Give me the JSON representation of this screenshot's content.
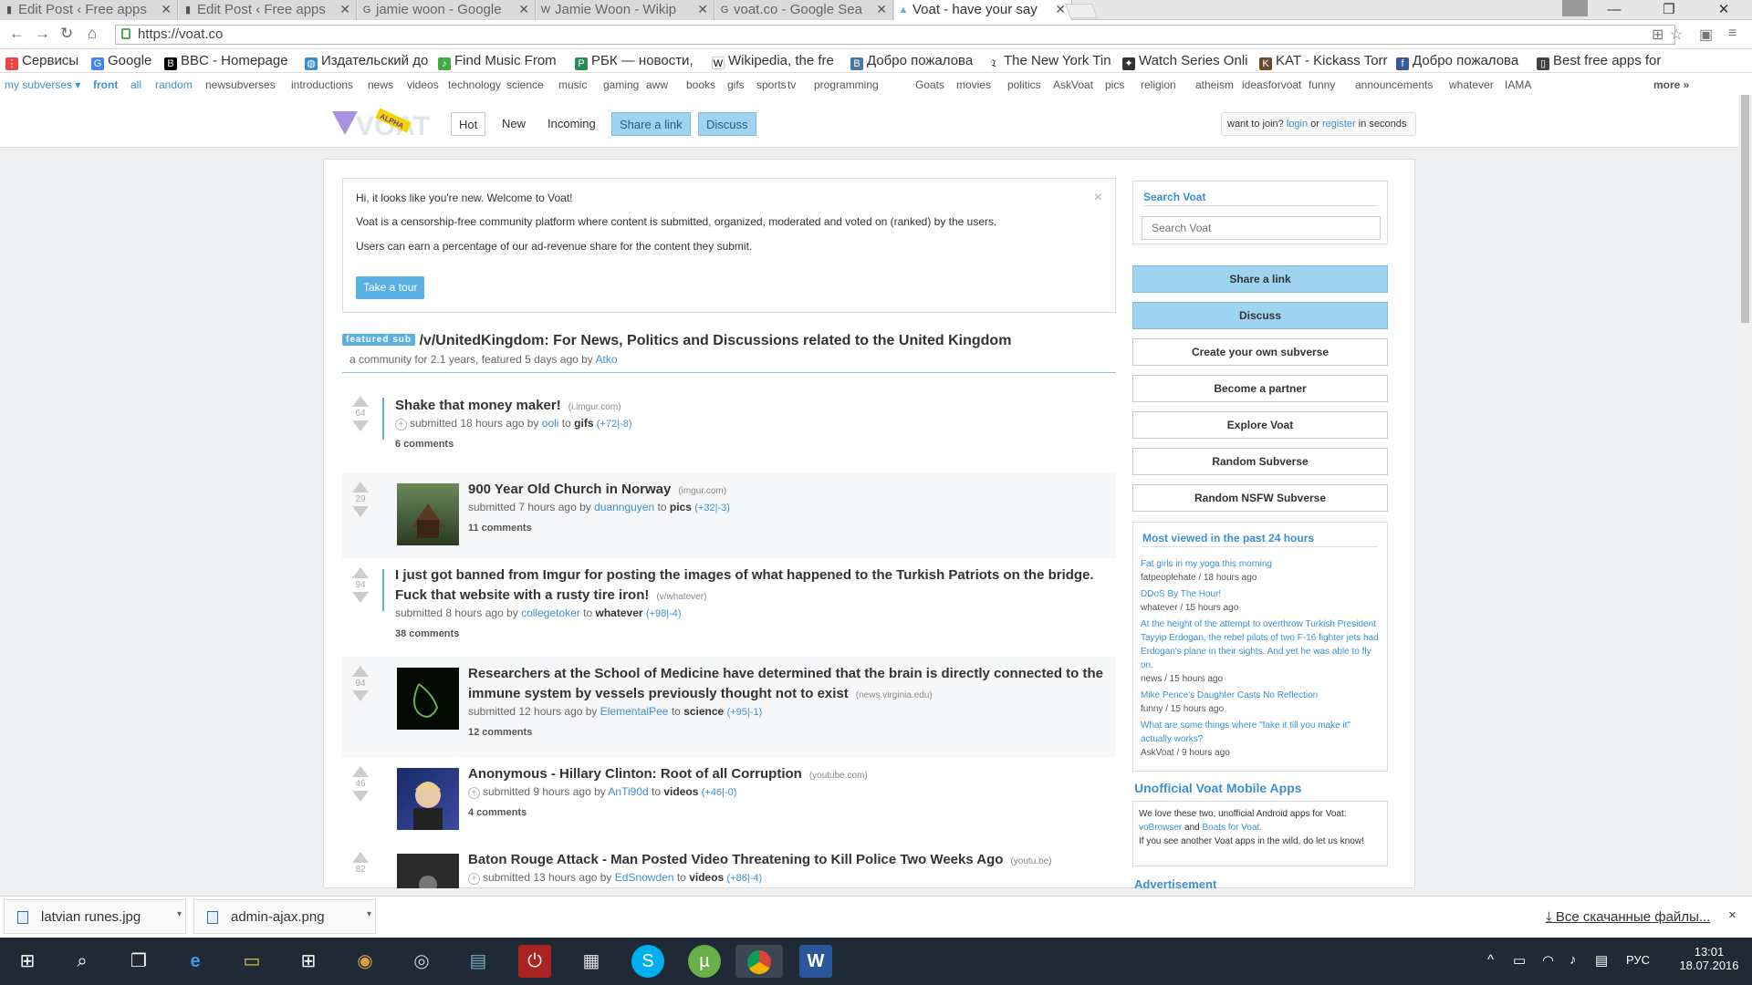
{
  "tabs": [
    {
      "label": "Edit Post ‹ Free apps"
    },
    {
      "label": "Edit Post ‹ Free apps"
    },
    {
      "label": "jamie woon - Google"
    },
    {
      "label": "Jamie Woon - Wikip"
    },
    {
      "label": "voat.co - Google Sea"
    },
    {
      "label": "Voat - have your say"
    }
  ],
  "url": "https://voat.co",
  "bookmarks": [
    "Сервисы",
    "Google",
    "BBC - Homepage",
    "Издательский до",
    "Find Music From",
    "РБК — новости,",
    "Wikipedia, the fre",
    "Добро пожалова",
    "The New York Tin",
    "Watch Series Onli",
    "KAT - Kickass Torr",
    "Добро пожалова",
    "Best free apps for"
  ],
  "subbar": {
    "my_subverses": "my subverses ▾",
    "items": [
      "front",
      "all",
      "random",
      "newsubverses",
      "introductions",
      "news",
      "videos",
      "technology",
      "science",
      "music",
      "gaming",
      "aww",
      "books",
      "gifs",
      "sports",
      "tv",
      "programming",
      "Goats",
      "movies",
      "politics",
      "AskVoat",
      "pics",
      "religion",
      "atheism",
      "ideasforvoat",
      "funny",
      "announcements",
      "whatever",
      "IAMA"
    ],
    "more": "more »"
  },
  "header": {
    "logo_text": "VOAT",
    "logo_badge": "ALPHA",
    "hot": "Hot",
    "new": "New",
    "incoming": "Incoming",
    "share": "Share a link",
    "discuss": "Discuss",
    "join_prefix": "want to join?",
    "login": "login",
    "or": "or",
    "register": "register",
    "join_suffix": "in seconds"
  },
  "welcome": {
    "line1": "Hi, it looks like you're new. Welcome to Voat!",
    "line2": "Voat is a censorship-free community platform where content is submitted, organized, moderated and voted on (ranked) by the users.",
    "line3": "Users can earn a percentage of our ad-revenue share for the content they submit.",
    "tour": "Take a tour",
    "close": "×"
  },
  "featured": {
    "badge": "featured sub",
    "title": "/v/UnitedKingdom: For News, Politics and Discussions related to the United Kingdom",
    "meta": "a community for 2.1 years, featured 5 days ago by",
    "user": "Atko"
  },
  "posts": [
    {
      "score": "64",
      "title": "Shake that money maker!",
      "domain": "(i.imgur.com)",
      "submitted": "submitted 18 hours ago by",
      "user": "ooli",
      "to": "to",
      "sub": "gifs",
      "ups": "+72",
      "sep": "|",
      "downs": "-8",
      "comments": "6 comments"
    },
    {
      "score": "29",
      "title": "900 Year Old Church in Norway",
      "domain": "(imgur.com)",
      "submitted": "submitted 7 hours ago by",
      "user": "duannguyen",
      "to": "to",
      "sub": "pics",
      "ups": "+32",
      "sep": "|",
      "downs": "-3",
      "comments": "11 comments"
    },
    {
      "score": "94",
      "title": "I just got banned from Imgur for posting the images of what happened to the Turkish Patriots on the bridge. Fuck that website with a rusty tire iron!",
      "domain": "(v/whatever)",
      "submitted": "submitted 8 hours ago by",
      "user": "collegetoker",
      "to": "to",
      "sub": "whatever",
      "ups": "+98",
      "sep": "|",
      "downs": "-4",
      "comments": "38 comments"
    },
    {
      "score": "94",
      "title": "Researchers at the School of Medicine have determined that the brain is directly connected to the immune system by vessels previously thought not to exist",
      "domain": "(news.virginia.edu)",
      "submitted": "submitted 12 hours ago by",
      "user": "ElementalPee",
      "to": "to",
      "sub": "science",
      "ups": "+95",
      "sep": "|",
      "downs": "-1",
      "comments": "12 comments"
    },
    {
      "score": "46",
      "title": "Anonymous - Hillary Clinton: Root of all Corruption",
      "domain": "(youtube.com)",
      "submitted": "submitted 9 hours ago by",
      "user": "AnTi90d",
      "to": "to",
      "sub": "videos",
      "ups": "+46",
      "sep": "|",
      "downs": "-0",
      "comments": "4 comments"
    },
    {
      "score": "82",
      "title": "Baton Rouge Attack - Man Posted Video Threatening to Kill Police Two Weeks Ago",
      "domain": "(youtu.be)",
      "submitted": "submitted 13 hours ago by",
      "user": "EdSnowden",
      "to": "to",
      "sub": "videos",
      "ups": "+86",
      "sep": "|",
      "downs": "-4",
      "comments": ""
    }
  ],
  "sidebar": {
    "search_title": "Search Voat",
    "search_placeholder": "Search Voat",
    "share": "Share a link",
    "discuss": "Discuss",
    "create": "Create your own subverse",
    "partner": "Become a partner",
    "explore": "Explore Voat",
    "random": "Random Subverse",
    "random_nsfw": "Random NSFW Subverse",
    "most_viewed_title": "Most viewed in the past 24 hours",
    "most_viewed": [
      {
        "title": "Fat girls in my yoga this morning",
        "meta": "fatpeoplehate / 18 hours ago"
      },
      {
        "title": "DDoS By The Hour!",
        "meta": "whatever / 15 hours ago"
      },
      {
        "title": "At the height of the attempt to overthrow Turkish President Tayyip Erdogan, the rebel pilots of two F-16 fighter jets had Erdogan's plane in their sights. And yet he was able to fly on.",
        "meta": "news / 15 hours ago"
      },
      {
        "title": "Mike Pence's Daughter Casts No Reflection",
        "meta": "funny / 15 hours ago"
      },
      {
        "title": "What are some things where \"fake it till you make it\" actually works?",
        "meta": "AskVoat / 9 hours ago"
      }
    ],
    "apps_title": "Unofficial Voat Mobile Apps",
    "apps_line1": "We love these two, unofficial Android apps for Voat:",
    "app1": "voBrowser",
    "apps_and": "and",
    "app2": "Boats for Voat.",
    "apps_line2": "If you see another Voat apps in the wild, do let us know!",
    "ad_title": "Advertisement"
  },
  "downloads": {
    "items": [
      "latvian runes.jpg",
      "admin-ajax.png"
    ],
    "all": "Все скачанные файлы...",
    "close": "×"
  },
  "taskbar": {
    "lang": "РУС",
    "time": "13:01",
    "date": "18.07.2016"
  }
}
